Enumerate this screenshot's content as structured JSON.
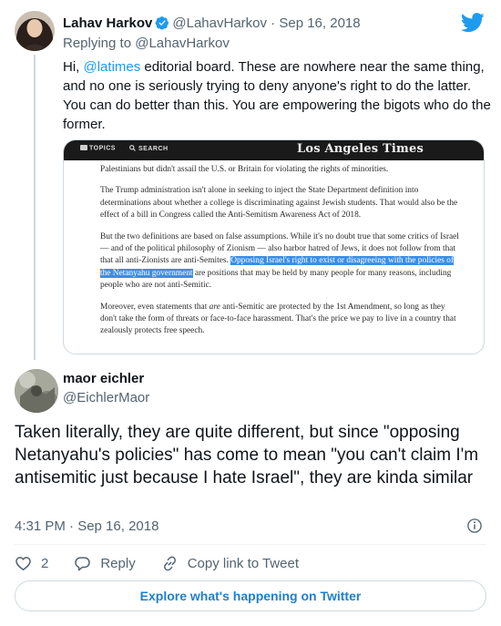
{
  "parent_tweet": {
    "author_name": "Lahav Harkov",
    "author_handle": "@LahavHarkov",
    "separator": "·",
    "date": "Sep 16, 2018",
    "replying_to_prefix": "Replying to ",
    "replying_to_handle": "@LahavHarkov",
    "text_before_mention": "Hi, ",
    "mention": "@latimes",
    "text_after_mention": " editorial board. These are nowhere near the same thing, and no one is seriously trying to deny anyone's right to do the latter. You can do better than this. You are empowering the bigots who do the former."
  },
  "attached_image": {
    "nav_topics": "TOPICS",
    "nav_search": "SEARCH",
    "masthead": "Los Angeles Times",
    "para1": "Palestinians but didn't assail the U.S. or Britain for violating the rights of minorities.",
    "para2": "The Trump administration isn't alone in seeking to inject the State Department definition into determinations about whether a college is discriminating against Jewish students. That would also be the effect of a bill in Congress called the Anti-Semitism Awareness Act of 2018.",
    "para3_before": "But the two definitions are based on false assumptions. While it's no doubt true that some critics of Israel — and of the political philosophy of Zionism — also harbor hatred of Jews, it does not follow from that that all anti-Zionists are anti-Semites. ",
    "para3_highlight": "Opposing Israel's right to exist or disagreeing with the policies of the Netanyahu government",
    "para3_after": " are positions that may be held by many people for many reasons, including people who are not anti-Semitic.",
    "para4_before": "Moreover, even statements that ",
    "para4_em": "are",
    "para4_after": " anti-Semitic are protected by the 1st Amendment, so long as they don't take the form of threats or face-to-face harassment. That's the price we pay to live in a country that zealously protects free speech."
  },
  "reply_tweet": {
    "author_name": "maor eichler",
    "author_handle": "@EichlerMaor",
    "text": "Taken literally, they are quite different, but since \"opposing Netanyahu's policies\" has come to mean \"you can't claim I'm antisemitic just because I hate Israel\", they are kinda similar",
    "time": "4:31 PM · Sep 16, 2018",
    "like_count": "2",
    "reply_label": "Reply",
    "copy_link_label": "Copy link to Tweet",
    "explore_label": "Explore what's happening on Twitter"
  },
  "colors": {
    "twitter_blue": "#1d9bf0",
    "muted": "#536471",
    "highlight": "#3b8ee6"
  },
  "icons": [
    "twitter-bird-icon",
    "verified-badge-icon",
    "info-icon",
    "heart-icon",
    "reply-icon",
    "link-icon"
  ]
}
